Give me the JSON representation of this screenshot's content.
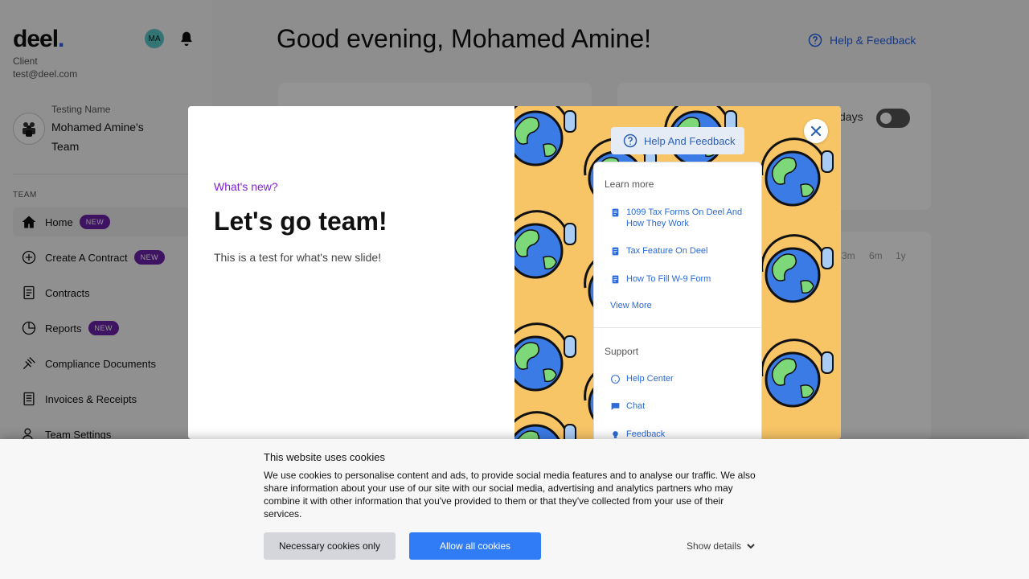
{
  "sidebar": {
    "logo": "deel",
    "logo_dot": ".",
    "avatar_initials": "MA",
    "client_role": "Client",
    "client_email": "test@deel.com",
    "team_sub": "Testing Name",
    "team_name": "Mohamed Amine's Team",
    "section_label": "TEAM",
    "items": [
      {
        "label": "Home",
        "badge": "NEW",
        "icon": "home-icon"
      },
      {
        "label": "Create A Contract",
        "badge": "NEW",
        "icon": "plus-circle-icon"
      },
      {
        "label": "Contracts",
        "badge": "",
        "icon": "contract-icon"
      },
      {
        "label": "Reports",
        "badge": "NEW",
        "icon": "pie-chart-icon"
      },
      {
        "label": "Compliance Documents",
        "badge": "",
        "icon": "gavel-icon"
      },
      {
        "label": "Invoices & Receipts",
        "badge": "",
        "icon": "invoice-icon"
      },
      {
        "label": "Team Settings",
        "badge": "",
        "icon": "team-settings-icon"
      }
    ]
  },
  "main": {
    "greeting": "Good evening, Mohamed Amine!",
    "help_link": "Help & Feedback",
    "days_label": "days",
    "ranges": [
      "3m",
      "6m",
      "1y"
    ]
  },
  "modal": {
    "eyebrow": "What's new?",
    "title": "Let's go team!",
    "description": "This is a test for what's new slide!",
    "illustration": {
      "pill_label": "Help And Feedback",
      "learn_more": "Learn more",
      "learn_links": [
        "1099 Tax Forms On Deel And How They Work",
        "Tax Feature On Deel",
        "How To Fill W-9 Form"
      ],
      "view_more": "View More",
      "support": "Support",
      "support_links": [
        "Help Center",
        "Chat",
        "Feedback"
      ]
    }
  },
  "cookie": {
    "title": "This website uses cookies",
    "body": "We use cookies to personalise content and ads, to provide social media features and to analyse our traffic. We also share information about your use of our site with our social media, advertising and analytics partners who may combine it with other information that you've provided to them or that they've collected from your use of their services.",
    "necessary_button": "Necessary cookies only",
    "allow_button": "Allow all cookies",
    "show_details": "Show details"
  },
  "colors": {
    "accent": "#2563eb",
    "badge": "#6b21a8",
    "eyebrow": "#7e22ce",
    "illustration_bg": "#f7c566",
    "cookie_allow": "#2f7cf6"
  }
}
